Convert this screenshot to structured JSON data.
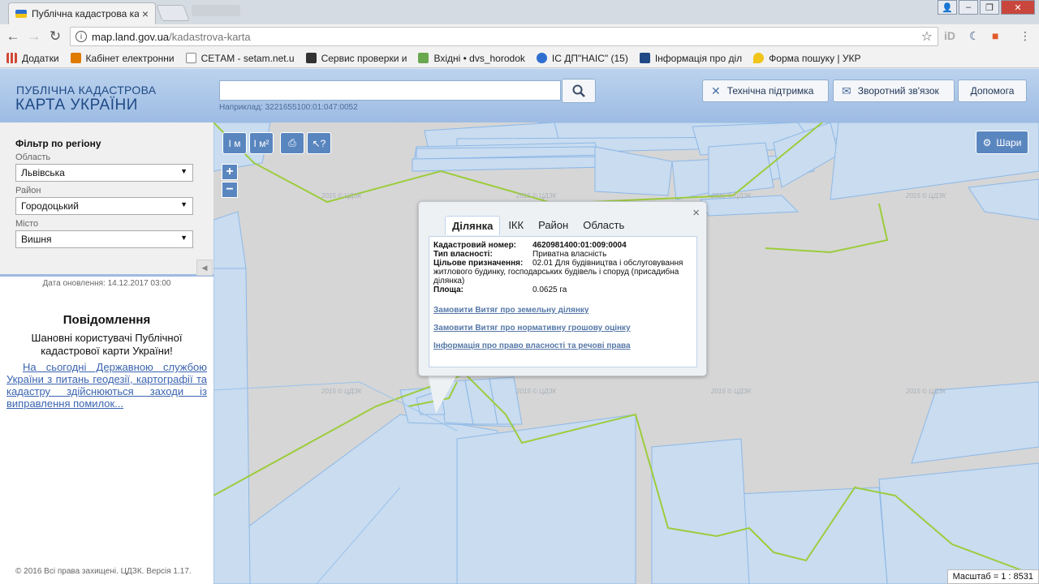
{
  "browser": {
    "tab_title": "Публічна кадастрова ка",
    "url_host": "map.land.gov.ua",
    "url_path": "/kadastrova-karta"
  },
  "bookmarks": [
    {
      "label": "Додатки",
      "color": "#d14836"
    },
    {
      "label": "Кабінет електронни",
      "color": "#e07b00"
    },
    {
      "label": "СЕТАМ - setam.net.u",
      "color": "#888888"
    },
    {
      "label": "Сервис проверки и",
      "color": "#333333"
    },
    {
      "label": "Вхідні • dvs_horodok",
      "color": "#6aa84f"
    },
    {
      "label": "ІС ДП\"НАІС\" (15)",
      "color": "#2f6fd0"
    },
    {
      "label": "Інформація про діл",
      "color": "#1f4a86"
    },
    {
      "label": "Форма пошуку | УКР",
      "color": "#f0c419"
    }
  ],
  "header": {
    "logo_top": "ПУБЛІЧНА КАДАСТРОВА",
    "logo_bottom": "КАРТА УКРАЇНИ",
    "search_hint": "Наприклад: 3221655100:01:047:0052",
    "support_label": "Технічна підтримка",
    "feedback_label": "Зворотний зв'язок",
    "help_label": "Допомога"
  },
  "sidebar": {
    "filter_title": "Фільтр по регіону",
    "oblast_label": "Область",
    "oblast_value": "Львівська",
    "raion_label": "Район",
    "raion_value": "Городоцький",
    "misto_label": "Місто",
    "misto_value": "Вишня",
    "update_date": "Дата оновлення: 14.12.2017 03:00",
    "notif_title": "Повідомлення",
    "notif_text": "Шановні користувачі Публічної кадастрової карти України!",
    "notif_link": "На сьогодні Державною службою України з питань геодезії, картографії та кадастру здійснюються заходи із виправлення помилок...",
    "copyright": "© 2016 Всі права захищені. ЦДЗК. Версія 1.17."
  },
  "map": {
    "tool_labels": [
      "I м",
      "I м²",
      "⎙",
      "↖?"
    ],
    "layers_label": "Шари",
    "scale": "Масштаб = 1 : 8531",
    "watermark": "2015 © ЦДЗК"
  },
  "popup": {
    "tabs": [
      "Ділянка",
      "ІКК",
      "Район",
      "Область"
    ],
    "cad_key": "Кадастровий номер:",
    "cad_val": "4620981400:01:009:0004",
    "own_key": "Тип власності:",
    "own_val": "Приватна власність",
    "purpose_key": "Цільове призначення:",
    "purpose_val": "02.01 Для будівництва і обслуговування житлового будинку, господарських будівель і споруд (присадибна ділянка)",
    "area_key": "Площа:",
    "area_val": "0.0625 га",
    "link1": "Замовити Витяг про земельну ділянку",
    "link2": "Замовити Витяг про нормативну грошову оцінку",
    "link3": "Інформація про право власності та речові права"
  }
}
